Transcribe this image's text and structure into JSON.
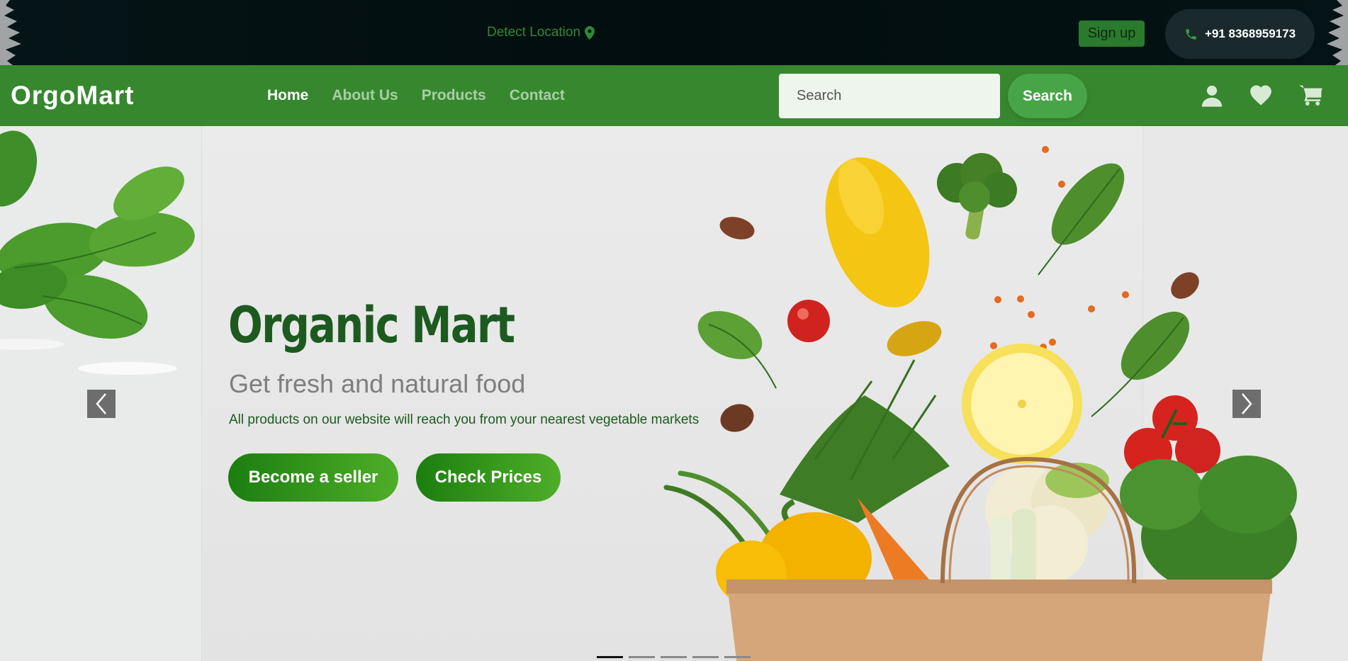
{
  "topbar": {
    "detect_location": "Detect Location",
    "signup_label": "Sign up",
    "phone": "+91 8368959173"
  },
  "nav": {
    "logo": "OrgoMart",
    "links": [
      "Home",
      "About Us",
      "Products",
      "Contact"
    ],
    "active_link": "Home",
    "search_placeholder": "Search",
    "search_button": "Search",
    "icons": [
      "user-icon",
      "heart-icon",
      "cart-icon"
    ]
  },
  "hero": {
    "title": "Organic Mart",
    "subtitle": "Get fresh and natural food",
    "description": "All products on our website will reach you from your nearest vegetable markets",
    "primary_button": "Become a seller",
    "secondary_button": "Check Prices",
    "slide_count": 5,
    "active_slide": 1
  },
  "colors": {
    "topbar_bg": "#020d0f",
    "nav_green": "#37872f",
    "title_green": "#1d5a1f",
    "button_green": "#2a8c1a"
  }
}
